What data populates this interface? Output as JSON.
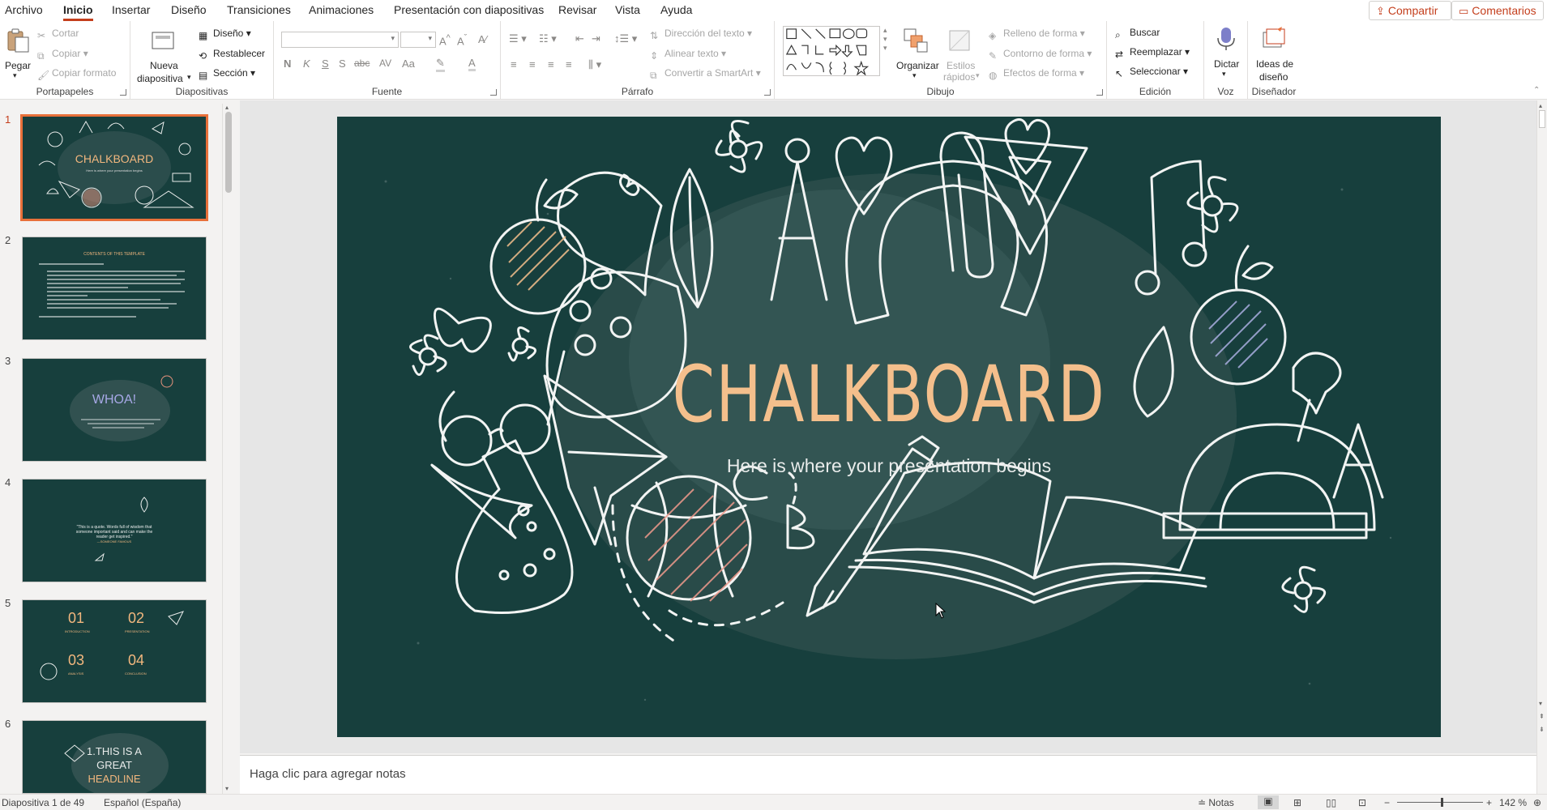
{
  "menu": {
    "tabs": [
      "Archivo",
      "Inicio",
      "Insertar",
      "Diseño",
      "Transiciones",
      "Animaciones",
      "Presentación con diapositivas",
      "Revisar",
      "Vista",
      "Ayuda"
    ],
    "active": "Inicio",
    "share_label": "Compartir",
    "comments_label": "Comentarios"
  },
  "ribbon": {
    "clipboard": {
      "label": "Portapapeles",
      "paste": "Pegar",
      "cut": "Cortar",
      "copy": "Copiar",
      "format_painter": "Copiar formato"
    },
    "slides": {
      "label": "Diapositivas",
      "new_slide_1": "Nueva",
      "new_slide_2": "diapositiva",
      "layout": "Diseño",
      "reset": "Restablecer",
      "section": "Sección"
    },
    "font": {
      "label": "Fuente",
      "bold": "N",
      "italic": "K",
      "underline": "S",
      "shadow": "S",
      "strike": "abc",
      "spacing": "AV",
      "case": "Aa"
    },
    "paragraph": {
      "label": "Párrafo",
      "text_direction": "Dirección del texto",
      "align_text": "Alinear texto",
      "smartart": "Convertir a SmartArt"
    },
    "drawing": {
      "label": "Dibujo",
      "arrange": "Organizar",
      "quick_styles_1": "Estilos",
      "quick_styles_2": "rápidos",
      "shape_fill": "Relleno de forma",
      "shape_outline": "Contorno de forma",
      "shape_effects": "Efectos de forma"
    },
    "editing": {
      "label": "Edición",
      "find": "Buscar",
      "replace": "Reemplazar",
      "select": "Seleccionar"
    },
    "voice": {
      "label": "Voz",
      "dictate": "Dictar"
    },
    "designer": {
      "label": "Diseñador",
      "ideas_1": "Ideas de",
      "ideas_2": "diseño"
    }
  },
  "slides_panel": {
    "numbers": [
      "1",
      "2",
      "3",
      "4",
      "5",
      "6"
    ],
    "thumb1_title": "CHALKBOARD",
    "thumb1_sub": "Here is where your presentation begins",
    "thumb2_title": "CONTENTS OF THIS TEMPLATE",
    "thumb3_title": "WHOA!",
    "thumb4_quote": "\"This is a quote. Words full of wisdom that someone important said and can make the reader get inspired.\"",
    "thumb4_author": "—SOMEONE FAMOUS",
    "thumb5": {
      "n1": "01",
      "n2": "02",
      "n3": "03",
      "n4": "04",
      "t1": "INTRODUCTION",
      "t2": "PRESENTATION",
      "t3": "ANALYSIS",
      "t4": "CONCLUSION"
    },
    "thumb6_l1": "1.THIS IS A",
    "thumb6_l2": "GREAT",
    "thumb6_l3": "HEADLINE"
  },
  "slide": {
    "title": "CHALKBOARD",
    "subtitle": "Here is where your presentation begins"
  },
  "notes_placeholder": "Haga clic para agregar notas",
  "status": {
    "slide_counter": "Diapositiva 1 de 49",
    "language": "Español (España)",
    "notes": "Notas",
    "zoom": "142 %"
  },
  "colors": {
    "accent": "#c43e1c",
    "slide_bg": "#173f3d",
    "title": "#f4bf8c"
  }
}
